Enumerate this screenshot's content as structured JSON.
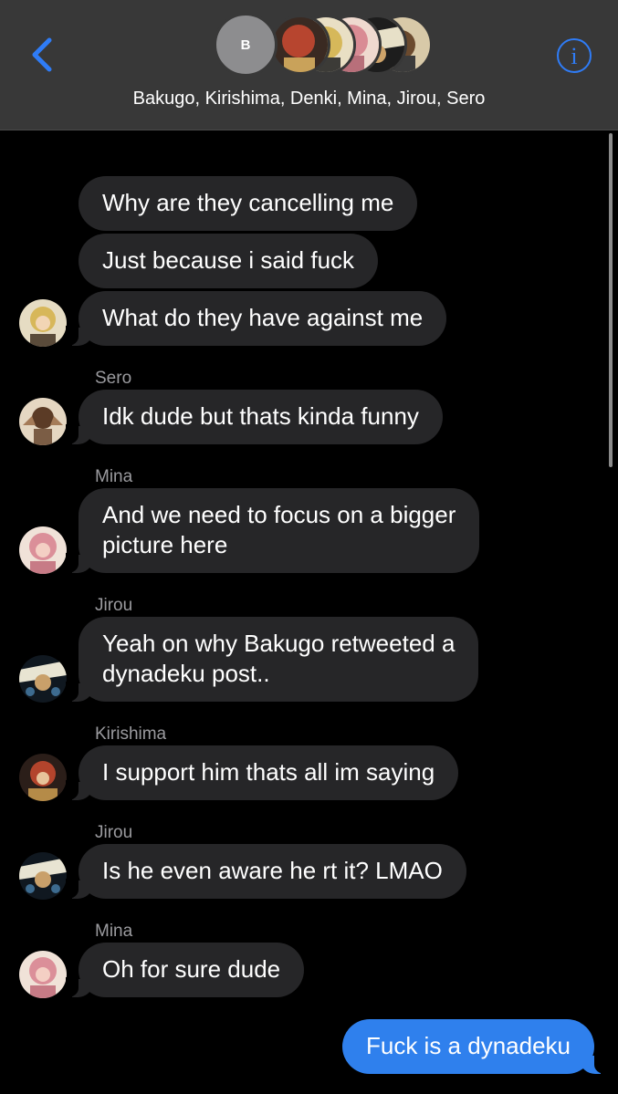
{
  "header": {
    "group_initial": "B",
    "group_names": "Bakugo, Kirishima, Denki, Mina, Jirou, Sero",
    "info_glyph": "i",
    "back_icon": "chevron-left-icon",
    "accent": "#2f7cf6"
  },
  "messages": [
    {
      "text": "Why are they cancelling me"
    },
    {
      "text": "Just because i said fuck"
    },
    {
      "text": "What do they have against me"
    },
    {
      "sender": "Sero",
      "text": "Idk dude but thats kinda funny"
    },
    {
      "sender": "Mina",
      "line1": "And we need to focus on a bigger",
      "line2": "picture here"
    },
    {
      "sender": "Jirou",
      "line1": "Yeah on why Bakugo retweeted a",
      "line2": "dynadeku post.."
    },
    {
      "sender": "Kirishima",
      "text": "I support him thats all im saying"
    },
    {
      "sender": "Jirou",
      "text": "Is he even aware he rt it? LMAO"
    },
    {
      "sender": "Mina",
      "text": "Oh for sure dude"
    },
    {
      "text": "Fuck is a dynadeku",
      "outgoing": true
    }
  ],
  "colors": {
    "incoming_bubble": "#262628",
    "outgoing_bubble": "#2f80ed",
    "header_bg": "#383838",
    "sender_label": "#9b9b9f"
  }
}
